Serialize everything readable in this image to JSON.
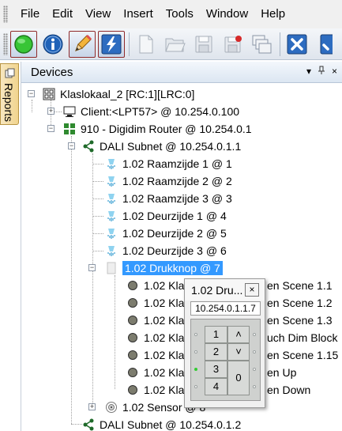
{
  "menu": [
    "File",
    "Edit",
    "View",
    "Insert",
    "Tools",
    "Window",
    "Help"
  ],
  "toolbar": {
    "buttons": [
      "connect-green-icon",
      "info-icon",
      "pencil-icon",
      "lightning-icon",
      "new-document-icon",
      "open-folder-icon",
      "save-icon",
      "save-red-icon",
      "windows-icon",
      "close-x-icon",
      "check-icon"
    ]
  },
  "side_tab": {
    "label": "Reports"
  },
  "panel": {
    "title": "Devices",
    "pin_glyph": "p",
    "close_glyph": "×"
  },
  "tree": {
    "root": "Klaslokaal_2 [RC:1][LRC:0]",
    "client": "Client:<LPT57> @ 10.254.0.100",
    "router": "910 - Digidim Router @ 10.254.0.1",
    "subnet1": "DALI Subnet @ 10.254.0.1.1",
    "lamps": [
      "1.02 Raamzijde 1 @ 1",
      "1.02 Raamzijde 2 @ 2",
      "1.02 Raamzijde 3 @ 3",
      "1.02 Deurzijde 1 @ 4",
      "1.02 Deurzijde 2 @ 5",
      "1.02 Deurzijde 3 @ 6"
    ],
    "drukknop": "1.02 Drukknop @ 7",
    "buttons_left": [
      "1.02 Kla",
      "1.02 Kla",
      "1.02 Kla",
      "1.02 Kla",
      "1.02 Kla",
      "1.02 Kla",
      "1.02 Kla"
    ],
    "buttons_right": [
      "en Scene 1.1",
      "en Scene 1.2",
      "en Scene 1.3",
      "uch Dim Block",
      "en Scene 1.15",
      "en Up",
      "en Down"
    ],
    "sensor": "1.02 Sensor @ 8",
    "subnet2": "DALI Subnet @ 10.254.0.1.2"
  },
  "popup": {
    "title": "1.02 Dru...",
    "close_glyph": "×",
    "address": "10.254.0.1.1.7",
    "keys_left": [
      "1",
      "2",
      "3",
      "4"
    ],
    "key_up": "˄",
    "key_down": "˅",
    "key_zero": "0",
    "indicator_color": "#33cc33"
  }
}
